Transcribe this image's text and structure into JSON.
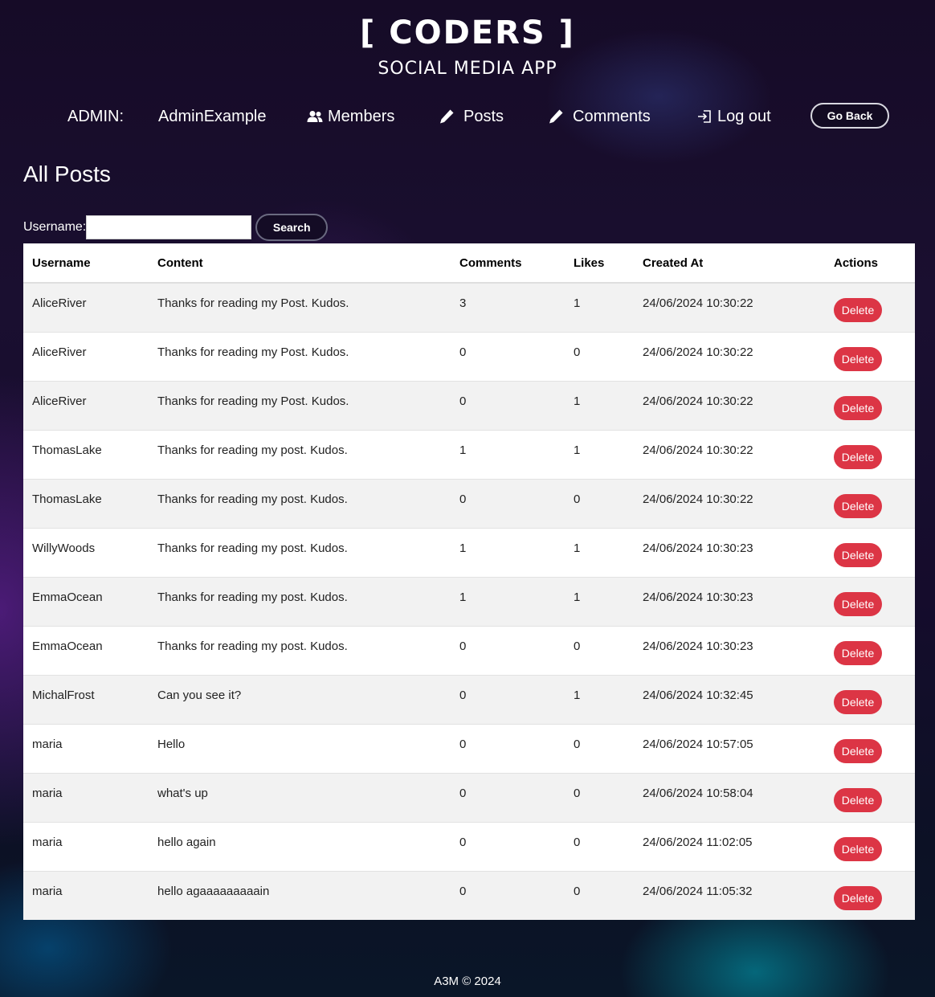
{
  "header": {
    "title": "[ CODERS ]",
    "subtitle": "SOCIAL MEDIA APP"
  },
  "nav": {
    "admin_label": "ADMIN:",
    "admin_name": "AdminExample",
    "members": "Members",
    "posts": "Posts",
    "comments": "Comments",
    "logout": "Log out",
    "go_back": "Go Back"
  },
  "page": {
    "heading": "All Posts"
  },
  "search": {
    "label": "Username:",
    "value": "",
    "button": "Search"
  },
  "table": {
    "columns": [
      "Username",
      "Content",
      "Comments",
      "Likes",
      "Created At",
      "Actions"
    ],
    "delete_label": "Delete",
    "rows": [
      {
        "username": "AliceRiver",
        "content": "Thanks for reading my Post. Kudos.",
        "comments": "3",
        "likes": "1",
        "created_at": "24/06/2024 10:30:22"
      },
      {
        "username": "AliceRiver",
        "content": "Thanks for reading my Post. Kudos.",
        "comments": "0",
        "likes": "0",
        "created_at": "24/06/2024 10:30:22"
      },
      {
        "username": "AliceRiver",
        "content": "Thanks for reading my Post. Kudos.",
        "comments": "0",
        "likes": "1",
        "created_at": "24/06/2024 10:30:22"
      },
      {
        "username": "ThomasLake",
        "content": "Thanks for reading my post. Kudos.",
        "comments": "1",
        "likes": "1",
        "created_at": "24/06/2024 10:30:22"
      },
      {
        "username": "ThomasLake",
        "content": "Thanks for reading my post. Kudos.",
        "comments": "0",
        "likes": "0",
        "created_at": "24/06/2024 10:30:22"
      },
      {
        "username": "WillyWoods",
        "content": "Thanks for reading my post. Kudos.",
        "comments": "1",
        "likes": "1",
        "created_at": "24/06/2024 10:30:23"
      },
      {
        "username": "EmmaOcean",
        "content": "Thanks for reading my post. Kudos.",
        "comments": "1",
        "likes": "1",
        "created_at": "24/06/2024 10:30:23"
      },
      {
        "username": "EmmaOcean",
        "content": "Thanks for reading my post. Kudos.",
        "comments": "0",
        "likes": "0",
        "created_at": "24/06/2024 10:30:23"
      },
      {
        "username": "MichalFrost",
        "content": "Can you see it?",
        "comments": "0",
        "likes": "1",
        "created_at": "24/06/2024 10:32:45"
      },
      {
        "username": "maria",
        "content": "Hello",
        "comments": "0",
        "likes": "0",
        "created_at": "24/06/2024 10:57:05"
      },
      {
        "username": "maria",
        "content": "what's up",
        "comments": "0",
        "likes": "0",
        "created_at": "24/06/2024 10:58:04"
      },
      {
        "username": "maria",
        "content": "hello again",
        "comments": "0",
        "likes": "0",
        "created_at": "24/06/2024 11:02:05"
      },
      {
        "username": "maria",
        "content": "hello agaaaaaaaaain",
        "comments": "0",
        "likes": "0",
        "created_at": "24/06/2024 11:05:32"
      }
    ]
  },
  "footer": {
    "text": "A3M © 2024"
  }
}
